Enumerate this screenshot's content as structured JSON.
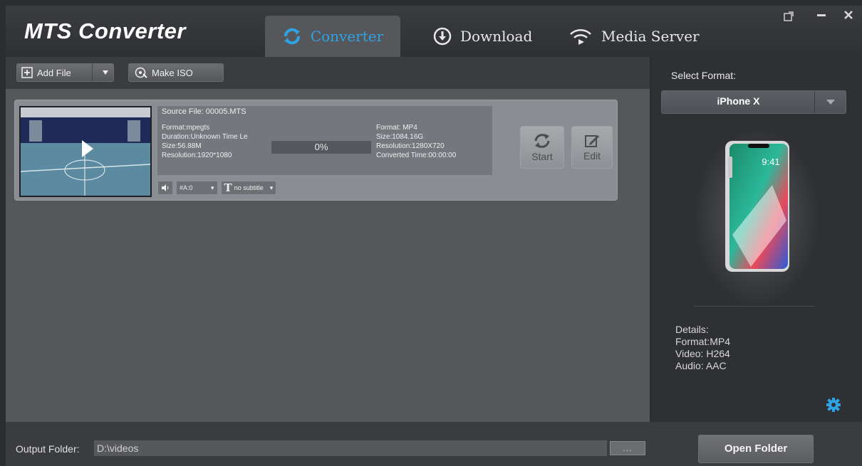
{
  "app": {
    "title": "MTS Converter"
  },
  "tabs": [
    {
      "label": "Converter",
      "active": true
    },
    {
      "label": "Download",
      "active": false
    },
    {
      "label": "Media Server",
      "active": false
    }
  ],
  "window_controls": [
    "external-icon",
    "minimize-icon",
    "close-icon"
  ],
  "toolbar": {
    "add_file_label": "Add File",
    "make_iso_label": "Make ISO"
  },
  "file": {
    "source_file": "Source File: 00005.MTS",
    "src_format": "Format:mpegts",
    "src_duration": "Duration:Unknown Time Le",
    "src_size": "Size:56.88M",
    "src_resolution": "Resolution:1920*1080",
    "progress_text": "0%",
    "progress_value": 0,
    "out_format": "Format: MP4",
    "out_size": "Size:1084.16G",
    "out_resolution": "Resolution:1280X720",
    "converted_time": "Converted Time:00:00:00",
    "audio_track": "#A:0",
    "subtitle": "no subtitle",
    "start_label": "Start",
    "edit_label": "Edit"
  },
  "format_panel": {
    "select_label": "Select Format:",
    "selected_format": "iPhone X",
    "phone_time": "9:41",
    "details_title": "Details:",
    "details_format": "Format:MP4",
    "details_video": "Video: H264",
    "details_audio": "Audio: AAC"
  },
  "bottom": {
    "output_label": "Output Folder:",
    "output_path": "D:\\videos",
    "browse_label": "...",
    "open_folder_label": "Open Folder"
  },
  "colors": {
    "accent": "#2fa3e6",
    "background": "#2b2d30",
    "panel": "#55575b"
  }
}
